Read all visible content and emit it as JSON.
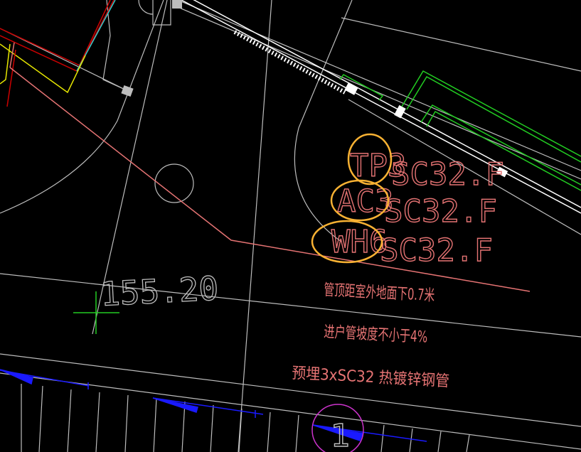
{
  "colors": {
    "background": "#000000",
    "grid": "#bdbdbd",
    "text": "#e57373",
    "highlight": "#f9b233",
    "green": "#22cc22",
    "blue": "#1a1aff",
    "magenta": "#cc33cc",
    "yellow": "#e6e600",
    "red": "#cc0000",
    "white": "#ffffff"
  },
  "pipe_labels": [
    {
      "code": "TP3",
      "spec": "SC32.F"
    },
    {
      "code": "AC3",
      "spec": "SC32.F"
    },
    {
      "code": "WH6",
      "spec": "SC32.F"
    }
  ],
  "notes": {
    "line1": "管顶距室外地面下0.7米",
    "line2": "进户管坡度不小于4%",
    "line3": "预埋3xSC32 热镀锌钢管"
  },
  "elevation": "155.20",
  "grid_marker": "1"
}
